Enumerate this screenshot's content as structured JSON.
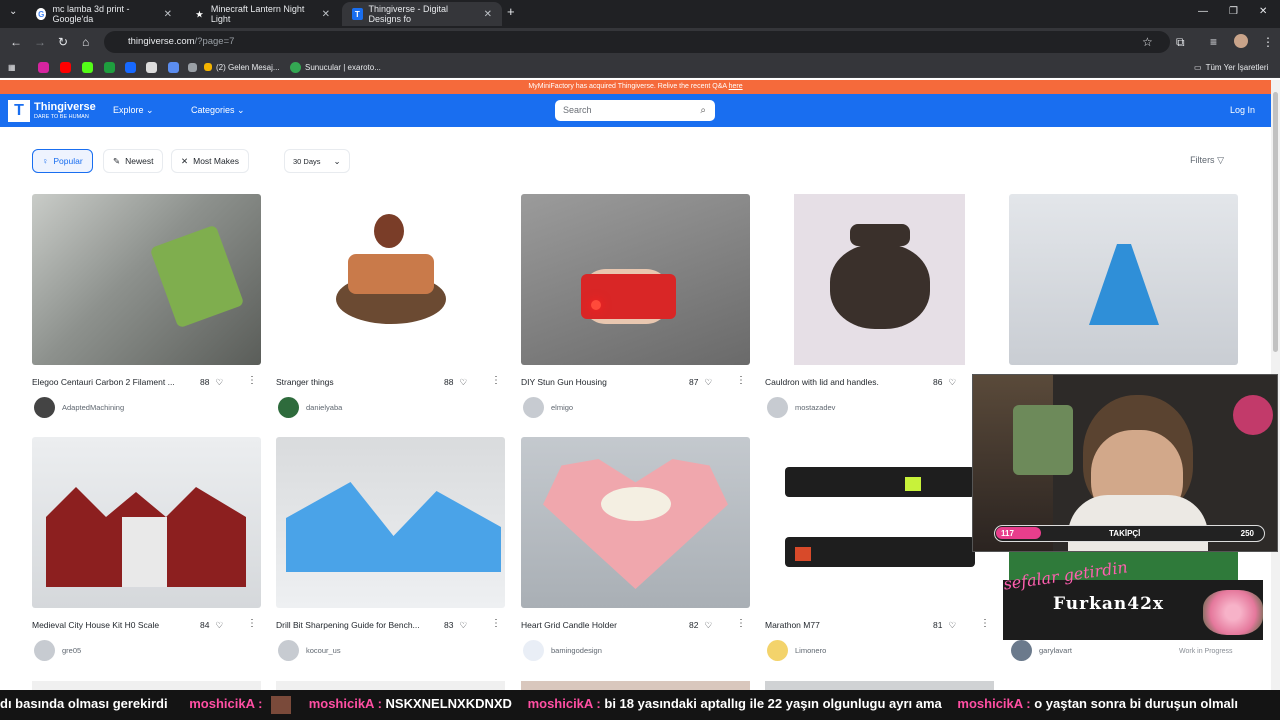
{
  "browser": {
    "tabs": [
      {
        "title": "mc lamba 3d print - Google'da"
      },
      {
        "title": "Minecraft Lantern Night Light"
      },
      {
        "title": "Thingiverse - Digital Designs fo"
      }
    ],
    "url_host": "thingiverse.com",
    "url_path": "/?page=7",
    "bookmarks": [
      "(2) Gelen Mesaj...",
      "Sunucular | exaroto...",
      "Tüm Yer İşaretleri"
    ]
  },
  "site": {
    "banner_text": "MyMiniFactory has acquired Thingiverse. Relive the recent Q&A",
    "banner_link": "here",
    "logo_name": "Thingiverse",
    "logo_tagline": "DARE TO BE HUMAN",
    "nav": {
      "explore": "Explore",
      "categories": "Categories",
      "login": "Log In"
    },
    "search_placeholder": "Search",
    "filters": {
      "popular": "Popular",
      "newest": "Newest",
      "most_makes": "Most Makes",
      "period": "30 Days",
      "filters": "Filters"
    }
  },
  "cards": [
    {
      "title": "Elegoo Centauri Carbon 2 Filament ...",
      "likes": "88",
      "author": "AdaptedMachining"
    },
    {
      "title": "Stranger things",
      "likes": "88",
      "author": "danielyaba"
    },
    {
      "title": "DIY Stun Gun Housing",
      "likes": "87",
      "author": "elmigo"
    },
    {
      "title": "Cauldron with lid and handles.",
      "likes": "86",
      "author": "mostazadev"
    },
    {
      "title": "",
      "likes": "",
      "author": ""
    },
    {
      "title": "Medieval City House Kit H0 Scale",
      "likes": "84",
      "author": "gre05"
    },
    {
      "title": "Drill Bit Sharpening Guide for Bench...",
      "likes": "83",
      "author": "kocour_us"
    },
    {
      "title": "Heart Grid Candle Holder",
      "likes": "82",
      "author": "bamingodesign"
    },
    {
      "title": "Marathon M77",
      "likes": "81",
      "author": "Limonero"
    },
    {
      "title": "",
      "likes": "",
      "author": "garylavart",
      "status": "Work in Progress"
    }
  ],
  "overlay": {
    "follow_current": "117",
    "follow_label": "TAKİPÇİ",
    "follow_goal": "250",
    "follow_fraction": 0.468,
    "streamer_name": "Furkan42x",
    "streamer_script": "sefalar getirdin",
    "chat": [
      {
        "user": "",
        "text": "dı basında olması gerekirdi"
      },
      {
        "user": "moshicikA :",
        "text": ""
      },
      {
        "user": "moshicikA :",
        "text": "NSKXNELNXKDNXD"
      },
      {
        "user": "moshicikA :",
        "text": "bi 18 yasındaki aptallıg ile 22 yaşın olgunlugu ayrı ama"
      },
      {
        "user": "moshicikA :",
        "text": "o yaştan sonra bi duruşun olmalı"
      }
    ]
  },
  "colors": {
    "brand": "#196ef0",
    "banner": "#f56a3b",
    "chat_user": "#ff4fa3"
  }
}
